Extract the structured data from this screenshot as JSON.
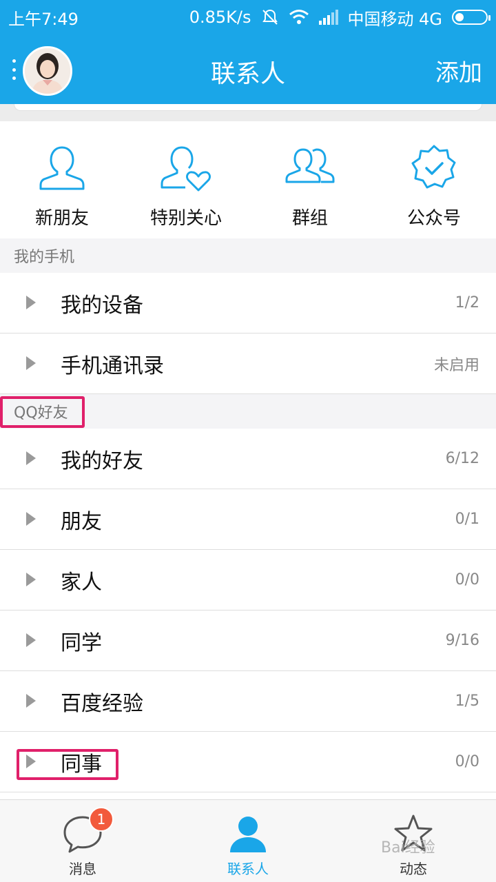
{
  "status_bar": {
    "time": "上午7:49",
    "speed": "0.85K/s",
    "carrier": "中国移动 4G"
  },
  "header": {
    "title": "联系人",
    "add_label": "添加"
  },
  "quick": [
    {
      "label": "新朋友",
      "icon": "new-friend-icon"
    },
    {
      "label": "特别关心",
      "icon": "special-care-icon"
    },
    {
      "label": "群组",
      "icon": "group-icon"
    },
    {
      "label": "公众号",
      "icon": "public-account-icon"
    }
  ],
  "sections": {
    "phone": {
      "title": "我的手机",
      "rows": [
        {
          "name": "我的设备",
          "count": "1/2"
        },
        {
          "name": "手机通讯录",
          "count": "未启用"
        }
      ]
    },
    "qq": {
      "title": "QQ好友",
      "rows": [
        {
          "name": "我的好友",
          "count": "6/12"
        },
        {
          "name": "朋友",
          "count": "0/1"
        },
        {
          "name": "家人",
          "count": "0/0"
        },
        {
          "name": "同学",
          "count": "9/16"
        },
        {
          "name": "百度经验",
          "count": "1/5"
        },
        {
          "name": "同事",
          "count": "0/0"
        }
      ]
    }
  },
  "bottom_nav": {
    "tabs": [
      {
        "label": "消息",
        "badge": "1"
      },
      {
        "label": "联系人"
      },
      {
        "label": "动态"
      }
    ]
  },
  "watermark": "Bai经验",
  "colors": {
    "accent": "#1aa6e8",
    "highlight": "#e0206a",
    "badge": "#f25a3c"
  }
}
